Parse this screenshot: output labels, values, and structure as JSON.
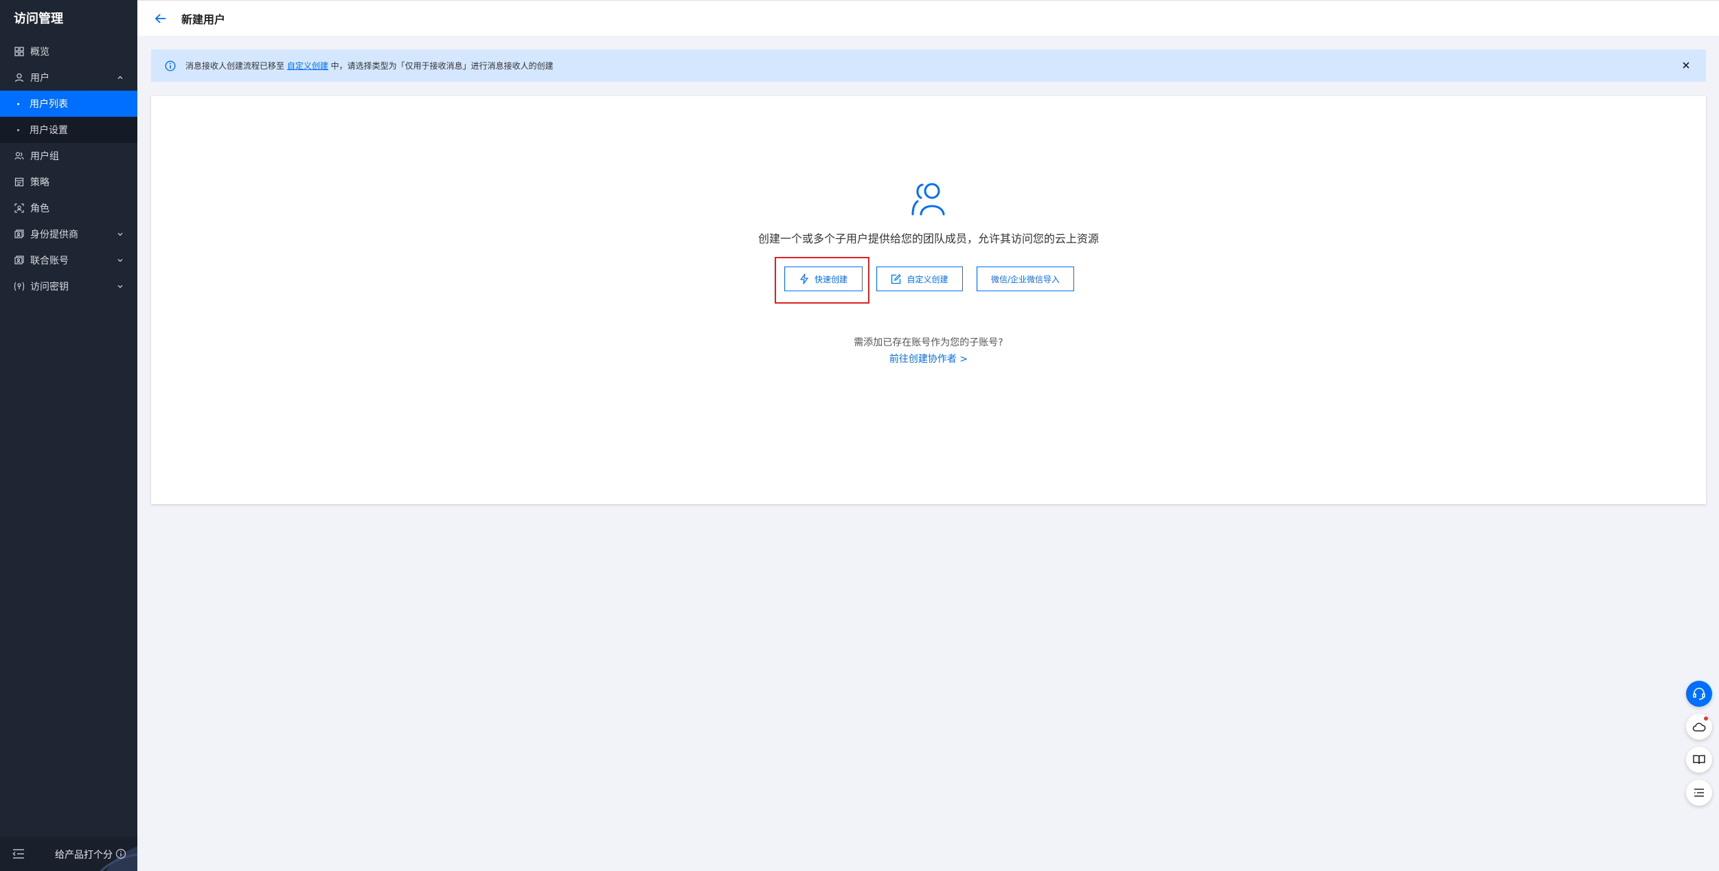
{
  "sidebar": {
    "title": "访问管理",
    "items": [
      {
        "label": "概览",
        "icon": "grid-icon"
      },
      {
        "label": "用户",
        "icon": "user-icon",
        "expanded": true,
        "children": [
          {
            "label": "用户列表",
            "active": true
          },
          {
            "label": "用户设置"
          }
        ]
      },
      {
        "label": "用户组",
        "icon": "user-group-icon"
      },
      {
        "label": "策略",
        "icon": "policy-icon"
      },
      {
        "label": "角色",
        "icon": "role-icon"
      },
      {
        "label": "身份提供商",
        "icon": "identity-provider-icon",
        "expandable": true
      },
      {
        "label": "联合账号",
        "icon": "federated-account-icon",
        "expandable": true
      },
      {
        "label": "访问密钥",
        "icon": "key-icon",
        "expandable": true
      }
    ],
    "footer": {
      "feedback_label": "给产品打个分"
    }
  },
  "header": {
    "title": "新建用户"
  },
  "notice": {
    "text_before": "消息接收人创建流程已移至 ",
    "link": "自定义创建",
    "text_after": " 中，请选择类型为「仅用于接收消息」进行消息接收人的创建"
  },
  "main": {
    "description": "创建一个或多个子用户提供给您的团队成员，允许其访问您的云上资源",
    "buttons": {
      "quick": "快速创建",
      "custom": "自定义创建",
      "import": "微信/企业微信导入"
    },
    "collaborator_question": "需添加已存在账号作为您的子账号?",
    "collaborator_link": "前往创建协作者 >"
  },
  "colors": {
    "accent": "#006eff",
    "sidebar_bg": "#1f2633",
    "highlight": "#e02020"
  }
}
